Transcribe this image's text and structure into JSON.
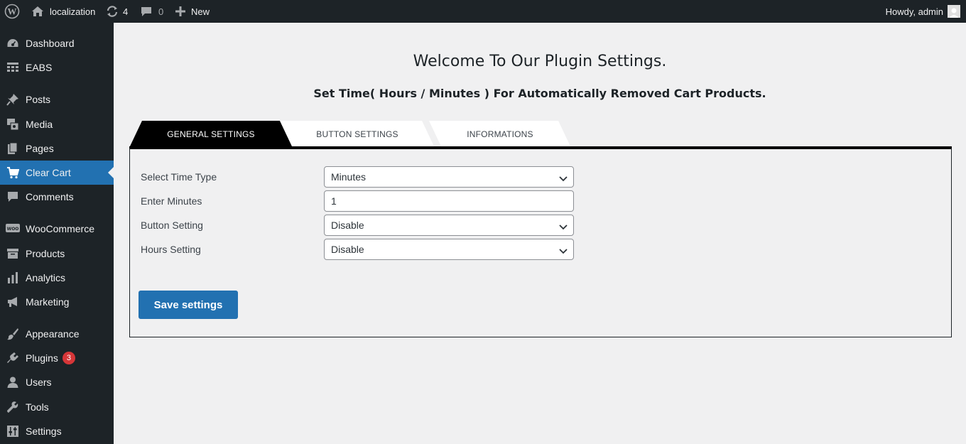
{
  "adminbar": {
    "site_name": "localization",
    "updates_count": "4",
    "comments_count": "0",
    "new_label": "New",
    "greeting": "Howdy, admin"
  },
  "sidebar": {
    "items": [
      {
        "label": "Dashboard",
        "icon": "dashboard-icon"
      },
      {
        "label": "EABS",
        "icon": "grid-icon"
      },
      {
        "label": "Posts",
        "icon": "pin-icon"
      },
      {
        "label": "Media",
        "icon": "media-icon"
      },
      {
        "label": "Pages",
        "icon": "pages-icon"
      },
      {
        "label": "Clear Cart",
        "icon": "cart-icon",
        "current": true
      },
      {
        "label": "Comments",
        "icon": "comment-icon"
      },
      {
        "label": "WooCommerce",
        "icon": "woo-icon"
      },
      {
        "label": "Products",
        "icon": "archive-icon"
      },
      {
        "label": "Analytics",
        "icon": "bar-chart-icon"
      },
      {
        "label": "Marketing",
        "icon": "megaphone-icon"
      },
      {
        "label": "Appearance",
        "icon": "brush-icon"
      },
      {
        "label": "Plugins",
        "icon": "plugin-icon",
        "badge": "3"
      },
      {
        "label": "Users",
        "icon": "user-icon"
      },
      {
        "label": "Tools",
        "icon": "wrench-icon"
      },
      {
        "label": "Settings",
        "icon": "sliders-icon"
      }
    ]
  },
  "page": {
    "welcome": "Welcome To Our Plugin Settings.",
    "subtitle": "Set Time( Hours / Minutes ) For Automatically Removed Cart Products."
  },
  "tabs": [
    {
      "label": "GENERAL SETTINGS",
      "active": true
    },
    {
      "label": "BUTTON SETTINGS",
      "active": false
    },
    {
      "label": "INFORMATIONS",
      "active": false
    }
  ],
  "form": {
    "fields": [
      {
        "label": "Select Time Type",
        "value": "Minutes",
        "type": "select"
      },
      {
        "label": "Enter Minutes",
        "value": "1",
        "type": "input"
      },
      {
        "label": "Button Setting",
        "value": "Disable",
        "type": "select"
      },
      {
        "label": "Hours Setting",
        "value": "Disable",
        "type": "select"
      }
    ],
    "save_label": "Save settings"
  },
  "colors": {
    "adminbar_bg": "#1d2327",
    "sidebar_bg": "#1d2327",
    "current_item": "#2271b1",
    "button": "#2271b1",
    "badge": "#d63638",
    "active_tab": "#000000"
  }
}
